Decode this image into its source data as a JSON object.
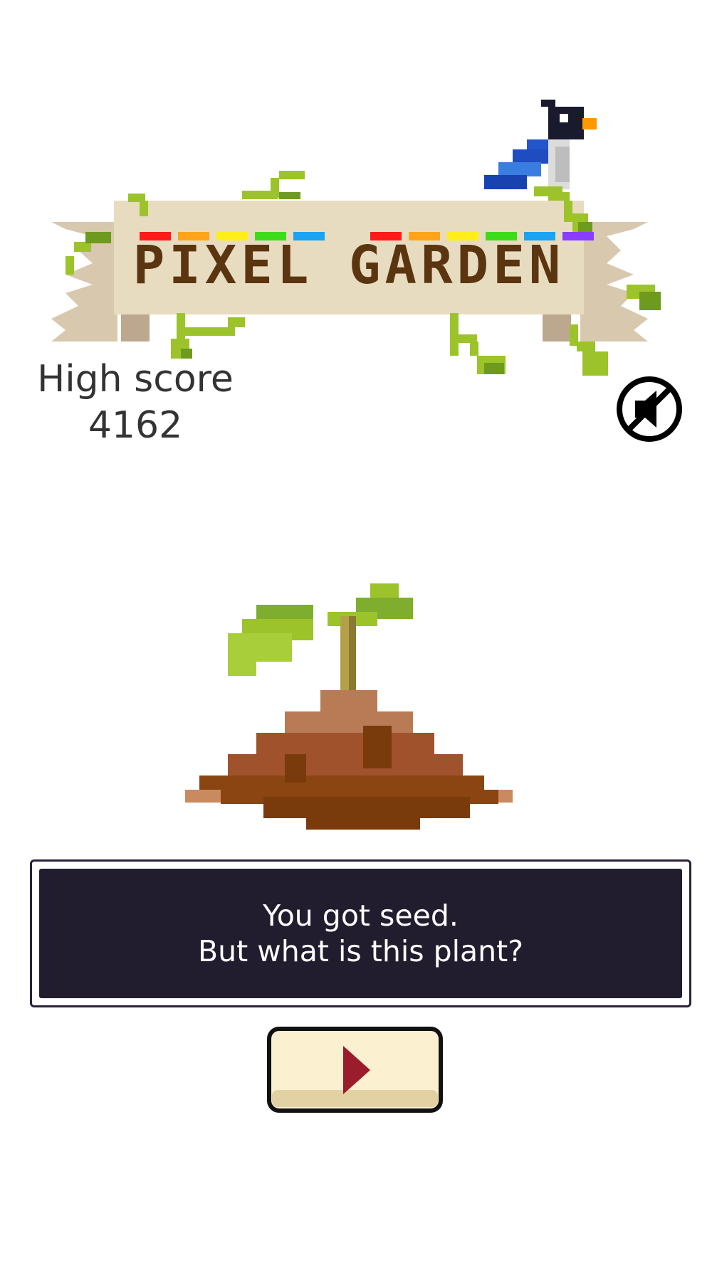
{
  "title": {
    "text": "PIXEL GARDEN",
    "letter_colors": [
      "#ff1a1a",
      "#ffa31a",
      "#ffee1a",
      "#3ddc1a",
      "#19a3f0",
      "#ff1a1a",
      "#ffa31a",
      "#ffee1a",
      "#3ddc1a",
      "#19a3f0",
      "#8a3dff"
    ],
    "text_color": "#5a3510",
    "ribbon_color": "#e8dcc0"
  },
  "high_score": {
    "label": "High score",
    "value": "4162"
  },
  "sound_toggle": {
    "icon": "sound-muted-icon"
  },
  "plant": {
    "stage": "seedling",
    "icon": "seedling-in-soil-icon"
  },
  "message": {
    "line1": "You got seed.",
    "line2": "But what is this plant?"
  },
  "play_button": {
    "icon": "play-triangle-icon",
    "color": "#9b1c2a"
  },
  "mascot": {
    "icon": "bluebird-icon"
  }
}
